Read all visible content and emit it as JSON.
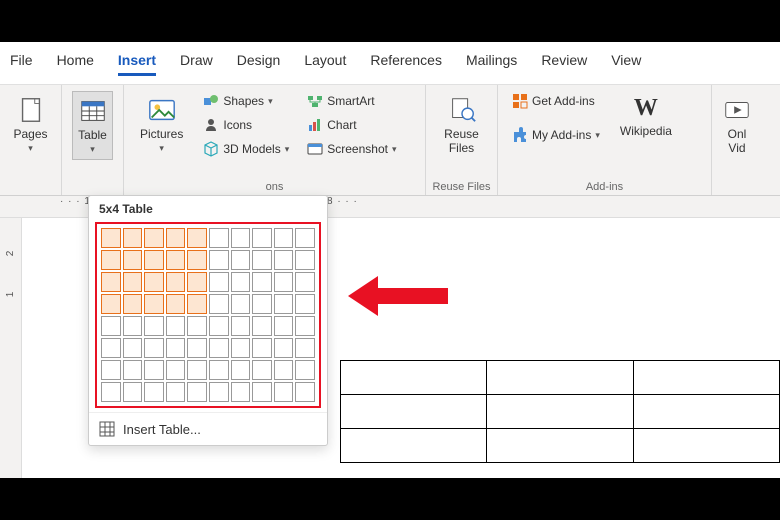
{
  "tabs": {
    "file": "File",
    "home": "Home",
    "insert": "Insert",
    "draw": "Draw",
    "design": "Design",
    "layout": "Layout",
    "references": "References",
    "mailings": "Mailings",
    "review": "Review",
    "view": "View"
  },
  "groups": {
    "pages": {
      "btn": "Pages",
      "label": ""
    },
    "tables": {
      "btn": "Table",
      "label": ""
    },
    "illustrations": {
      "pictures": "Pictures",
      "shapes": "Shapes",
      "icons": "Icons",
      "models3d": "3D Models",
      "smartart": "SmartArt",
      "chart": "Chart",
      "screenshot": "Screenshot",
      "label": "ons"
    },
    "reuse": {
      "btn": "Reuse\nFiles",
      "label": "Reuse Files"
    },
    "addins": {
      "get": "Get Add-ins",
      "my": "My Add-ins",
      "wiki": "Wikipedia",
      "label": "Add-ins"
    },
    "media": {
      "btn": "Onl\nVid"
    }
  },
  "tableDropdown": {
    "title": "5x4 Table",
    "selCols": 5,
    "selRows": 4,
    "gridCols": 10,
    "gridRows": 8,
    "insertTable": "Insert Table..."
  },
  "ruler": {
    "h": "· · · 1 · · · 2 · · · 3 · · · 4 · · · 5 · · · 6 · · · 7 · · · 8 · · · ",
    "v1": "2",
    "v2": "1"
  },
  "docTable": {
    "rows": 3,
    "cols": 3
  }
}
